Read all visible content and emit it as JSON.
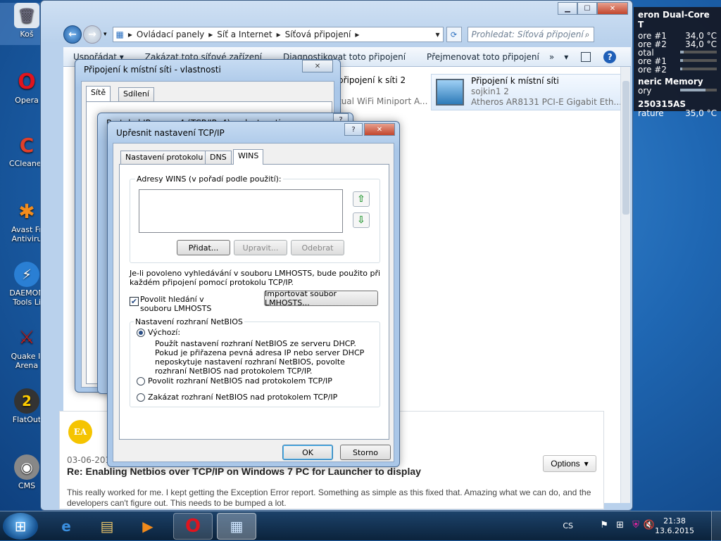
{
  "desktop": {
    "icons": [
      "Koš",
      "Opera",
      "CCleaner",
      "Avast Fr",
      "Antiviru",
      "DAEMON",
      "Tools Li",
      "Quake II",
      "Arena",
      "FlatOut",
      "CMS"
    ]
  },
  "gadget": {
    "cpu_title": "eron Dual-Core T",
    "core1_label": "ore #1",
    "core1_value": "34,0 °C",
    "core2_label": "ore #2",
    "core2_value": "34,0 °C",
    "total_label": "otal",
    "core1b_label": "ore #1",
    "core2b_label": "ore #2",
    "memory_title": "neric Memory",
    "memory_label": "ory",
    "disk_title": "250315AS",
    "temp_label": "rature",
    "temp_value": "35,0 °C"
  },
  "explorer": {
    "breadcrumb": [
      "Ovládací panely",
      "Síť a Internet",
      "Síťová připojení"
    ],
    "search_placeholder": "Prohledat: Síťová připojení",
    "commands": [
      "Uspořádat ▾",
      "Zakázat toto síťové zařízení",
      "Diagnostikovat toto připojení",
      "Přejmenovat toto připojení"
    ],
    "more": "»",
    "items": [
      {
        "name": "připojení k síti 2",
        "adapter": "tual WiFi Miniport A..."
      },
      {
        "name": "Připojení k místní síti",
        "network": "sojkin1  2",
        "adapter": "Atheros AR8131 PCI-E Gigabit Eth..."
      }
    ]
  },
  "dialog1": {
    "title": "Připojení k místní síti - vlastnosti",
    "tabs": [
      "Sítě",
      "Sdílení"
    ]
  },
  "dialog2": {
    "title": "Protokol IP verze 4 (TCP/IPv4) – vlastnosti"
  },
  "dialog3": {
    "title": "Upřesnit nastavení TCP/IP",
    "tabs": [
      "Nastavení protokolu IP",
      "DNS",
      "WINS"
    ],
    "wins_group_label": "Adresy WINS (v pořadí podle použití):",
    "buttons": {
      "add": "Přidat...",
      "edit": "Upravit...",
      "remove": "Odebrat",
      "import": "Importovat soubor LMHOSTS...",
      "ok": "OK",
      "cancel": "Storno"
    },
    "lmhosts_text": "Je-li povoleno vyhledávání v souboru LMHOSTS, bude použito při každém připojení pomocí protokolu TCP/IP.",
    "lmhosts_checkbox": "Povolit hledání v souboru LMHOSTS",
    "lmhosts_checked": true,
    "netbios_label": "Nastavení rozhraní NetBIOS",
    "netbios_options": [
      "Výchozí:",
      "Povolit rozhraní NetBIOS nad protokolem TCP/IP",
      "Zakázat rozhraní NetBIOS nad protokolem TCP/IP"
    ],
    "netbios_selected": "Výchozí:",
    "netbios_default_desc": "Použít nastavení rozhraní NetBIOS ze serveru DHCP. Pokud je přiřazena pevná adresa IP nebo server DHCP neposkytuje nastavení rozhraní NetBIOS, povolte rozhraní NetBIOS nad protokolem TCP/IP."
  },
  "post": {
    "date": "03-06-2013",
    "title": "Re: Enabling Netbios over TCP/IP on Windows 7 PC for Launcher to display",
    "options_label": "Options",
    "body": "This really worked for me.  I kept getting the Exception Error report.  Something as simple as this fixed that.  Amazing what we can do, and the developers can't figure out.  This needs to be bumped a lot."
  },
  "taskbar": {
    "language": "CS",
    "time": "21:38",
    "date": "13.6.2015"
  }
}
